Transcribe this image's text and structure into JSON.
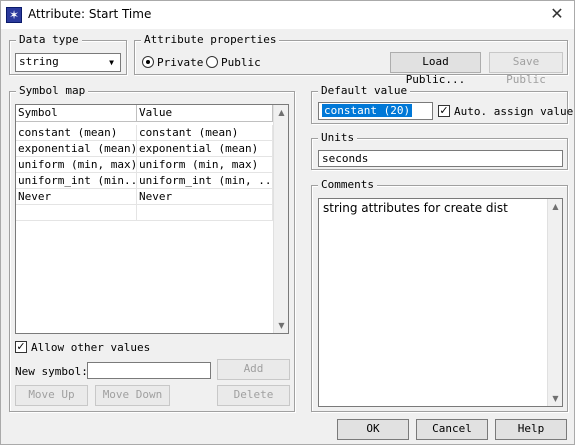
{
  "window": {
    "title": "Attribute: Start Time"
  },
  "data_type": {
    "legend": "Data type",
    "value": "string"
  },
  "attribute_properties": {
    "legend": "Attribute properties",
    "private_label": "Private",
    "public_label": "Public",
    "selected": "Private",
    "load_public_label": "Load Public...",
    "save_public_label": "Save Public"
  },
  "symbol_map": {
    "legend": "Symbol map",
    "headers": [
      "Symbol",
      "Value"
    ],
    "rows": [
      [
        "constant (mean)",
        "constant (mean)"
      ],
      [
        "exponential (mean)",
        "exponential (mean)"
      ],
      [
        "uniform (min, max)",
        "uniform (min, max)"
      ],
      [
        "uniform_int (min...",
        "uniform_int (min, ..."
      ],
      [
        "Never",
        "Never"
      ]
    ],
    "allow_other_values_label": "Allow other values",
    "allow_other_values_checked": true,
    "new_symbol_label": "New symbol:",
    "new_symbol_value": "",
    "add_label": "Add",
    "move_up_label": "Move Up",
    "move_down_label": "Move Down",
    "delete_label": "Delete"
  },
  "default_value": {
    "legend": "Default value",
    "value": "constant (20)",
    "auto_assign_label": "Auto. assign value",
    "auto_assign_checked": true
  },
  "units": {
    "legend": "Units",
    "value": "seconds"
  },
  "comments": {
    "legend": "Comments",
    "text": "string attributes for create dist"
  },
  "buttons": {
    "ok": "OK",
    "cancel": "Cancel",
    "help": "Help"
  },
  "icons": {
    "app": "app-icon",
    "close": "close-icon",
    "dropdown": "chevron-down-icon"
  },
  "colors": {
    "selection": "#0078d7",
    "title_icon": "#2b3a9c"
  }
}
